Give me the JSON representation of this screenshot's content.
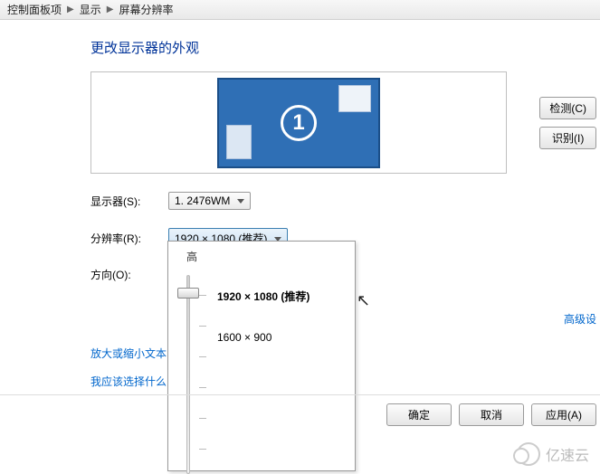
{
  "breadcrumb": {
    "item1": "控制面板项",
    "item2": "显示",
    "item3": "屏幕分辨率"
  },
  "page": {
    "title": "更改显示器的外观"
  },
  "monitor": {
    "number": "1"
  },
  "sideButtons": {
    "detect": "检测(C)",
    "identify": "识别(I)"
  },
  "form": {
    "displayLabel": "显示器(S):",
    "displayValue": "1. 2476WM",
    "resolutionLabel": "分辨率(R):",
    "resolutionValue": "1920 × 1080 (推荐)",
    "orientationLabel": "方向(O):"
  },
  "dropdown": {
    "highLabel": "高",
    "options": {
      "opt1": "1920 × 1080 (推荐)",
      "opt2": "1600 × 900"
    }
  },
  "links": {
    "zoom": "放大或缩小文本",
    "which": "我应该选择什么",
    "advanced": "高级设"
  },
  "bottom": {
    "ok": "确定",
    "cancel": "取消",
    "apply": "应用(A)"
  },
  "watermark": {
    "text": "亿速云"
  }
}
